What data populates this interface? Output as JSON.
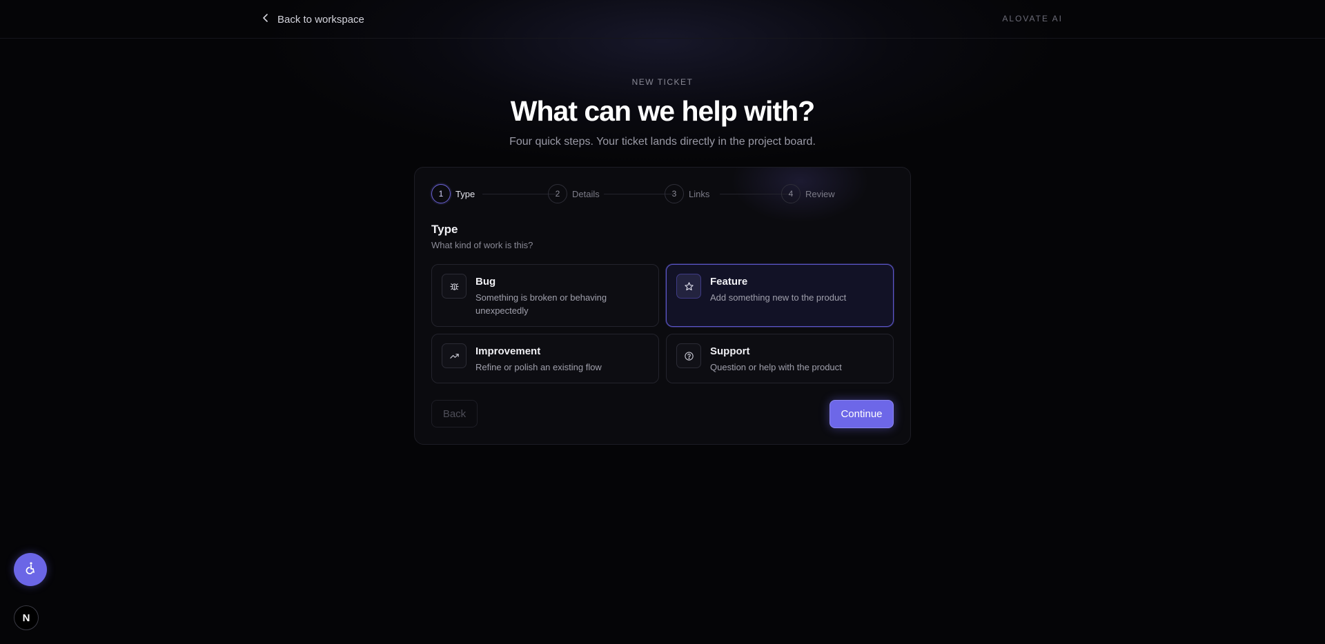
{
  "topbar": {
    "back_label": "Back to workspace",
    "brand": "ALOVATE AI"
  },
  "hero": {
    "eyebrow": "NEW TICKET",
    "title": "What can we help with?",
    "subtitle": "Four quick steps. Your ticket lands directly in the project board."
  },
  "stepper": {
    "steps": [
      {
        "number": "1",
        "label": "Type",
        "active": true
      },
      {
        "number": "2",
        "label": "Details",
        "active": false
      },
      {
        "number": "3",
        "label": "Links",
        "active": false
      },
      {
        "number": "4",
        "label": "Review",
        "active": false
      }
    ]
  },
  "section": {
    "title": "Type",
    "subtitle": "What kind of work is this?"
  },
  "options": [
    {
      "title": "Bug",
      "description": "Something is broken or behaving unexpectedly",
      "icon": "bug-icon",
      "selected": false
    },
    {
      "title": "Feature",
      "description": "Add something new to the product",
      "icon": "star-icon",
      "selected": true
    },
    {
      "title": "Improvement",
      "description": "Refine or polish an existing flow",
      "icon": "trend-up-icon",
      "selected": false
    },
    {
      "title": "Support",
      "description": "Question or help with the product",
      "icon": "help-circle-icon",
      "selected": false
    }
  ],
  "actions": {
    "back_label": "Back",
    "continue_label": "Continue"
  },
  "floating": {
    "accessibility_icon": "accessibility-icon",
    "badge_letter": "N"
  },
  "colors": {
    "background": "#050507",
    "accent": "#6d67e8",
    "card": "#0b0b0f"
  }
}
